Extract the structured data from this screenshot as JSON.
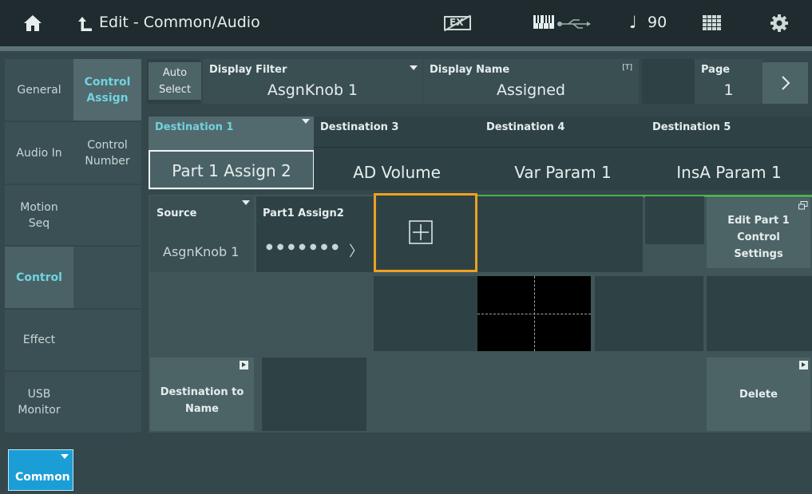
{
  "header": {
    "title": "Edit - Common/Audio",
    "home_icon": "home-icon",
    "back_icon": "return-icon",
    "ex_label": "EX",
    "tempo_symbol": "♩",
    "tempo": "90"
  },
  "nav_primary": [
    "General",
    "Audio In",
    "Motion Seq",
    "Control",
    "Effect",
    "USB Monitor"
  ],
  "nav_secondary": [
    "Control Assign",
    "Control Number"
  ],
  "part_button": "Common",
  "auto_select": "Auto Select",
  "display_filter": {
    "label": "Display Filter",
    "value": "AsgnKnob 1"
  },
  "display_name": {
    "label": "Display Name",
    "value": "Assigned",
    "icon": "[T]"
  },
  "page": {
    "label": "Page",
    "value": "1"
  },
  "destinations": [
    {
      "label": "Destination 1",
      "value": "Part 1 Assign 2"
    },
    {
      "label": "Destination 3",
      "value": "AD Volume"
    },
    {
      "label": "Destination 4",
      "value": "Var Param 1"
    },
    {
      "label": "Destination 5",
      "value": "InsA Param 1"
    }
  ],
  "source": {
    "label": "Source",
    "value": "AsgnKnob 1"
  },
  "part_assign": {
    "label": "Part1 Assign2",
    "dots": "●●●●●●●"
  },
  "edit_part_button": "Edit Part 1 Control Settings",
  "destination_to_name": "Destination to Name",
  "delete_button": "Delete"
}
